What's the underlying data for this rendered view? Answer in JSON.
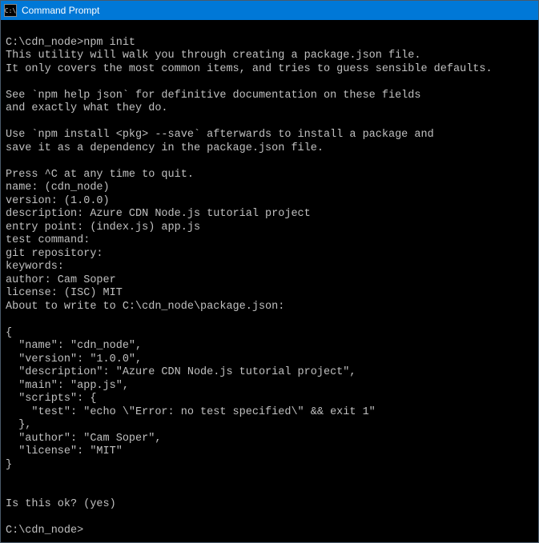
{
  "window": {
    "title": "Command Prompt",
    "icon_label": "C:\\"
  },
  "terminal": {
    "content": "\nC:\\cdn_node>npm init\nThis utility will walk you through creating a package.json file.\nIt only covers the most common items, and tries to guess sensible defaults.\n\nSee `npm help json` for definitive documentation on these fields\nand exactly what they do.\n\nUse `npm install <pkg> --save` afterwards to install a package and\nsave it as a dependency in the package.json file.\n\nPress ^C at any time to quit.\nname: (cdn_node)\nversion: (1.0.0)\ndescription: Azure CDN Node.js tutorial project\nentry point: (index.js) app.js\ntest command:\ngit repository:\nkeywords:\nauthor: Cam Soper\nlicense: (ISC) MIT\nAbout to write to C:\\cdn_node\\package.json:\n\n{\n  \"name\": \"cdn_node\",\n  \"version\": \"1.0.0\",\n  \"description\": \"Azure CDN Node.js tutorial project\",\n  \"main\": \"app.js\",\n  \"scripts\": {\n    \"test\": \"echo \\\"Error: no test specified\\\" && exit 1\"\n  },\n  \"author\": \"Cam Soper\",\n  \"license\": \"MIT\"\n}\n\n\nIs this ok? (yes)\n\nC:\\cdn_node>"
  }
}
